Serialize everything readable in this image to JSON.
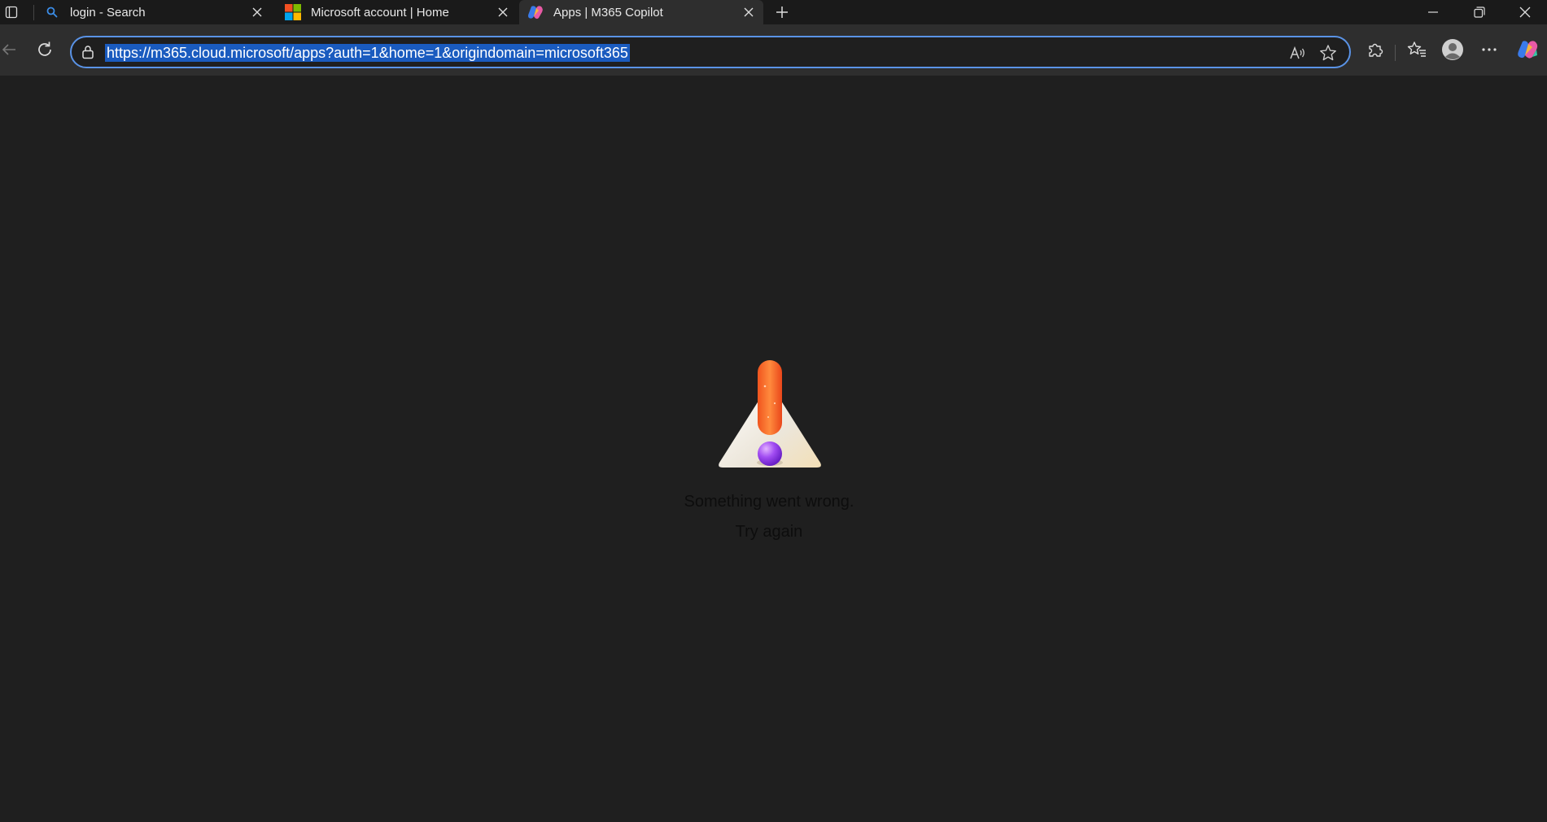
{
  "browser": {
    "tabs": [
      {
        "title": "login - Search",
        "favicon": "search-icon",
        "active": false
      },
      {
        "title": "Microsoft account | Home",
        "favicon": "microsoft-logo-icon",
        "active": false
      },
      {
        "title": "Apps | M365 Copilot",
        "favicon": "copilot-icon",
        "active": true
      }
    ],
    "address": {
      "url": "https://m365.cloud.microsoft/apps?auth=1&home=1&origindomain=microsoft365"
    }
  },
  "page": {
    "error_message": "Something went wrong.",
    "try_again": "Try again"
  },
  "colors": {
    "accent": "#5a93e6",
    "url_selection": "#1a5bbf",
    "background": "#1f1f1f"
  }
}
